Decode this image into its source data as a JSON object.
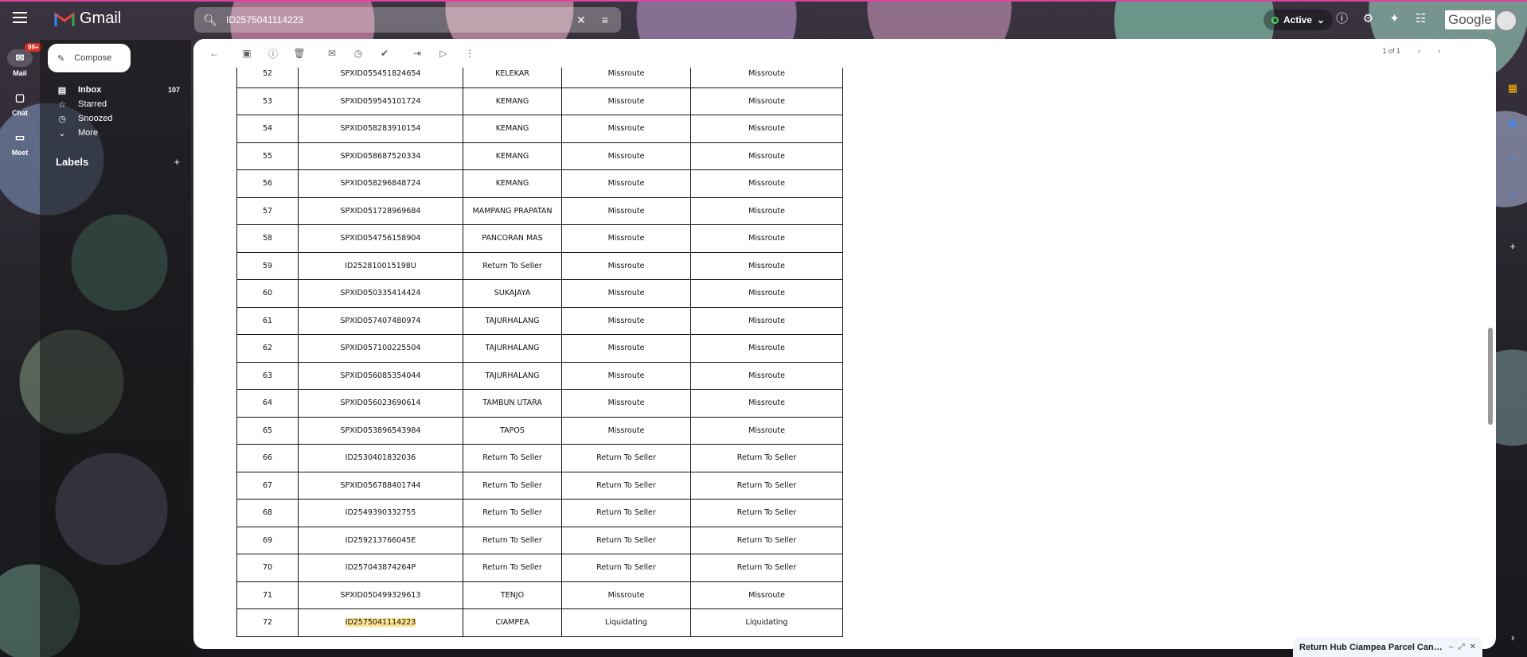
{
  "app": {
    "name": "Gmail"
  },
  "search": {
    "value": "ID2575041114223"
  },
  "status": {
    "label": "Active"
  },
  "google_label": "Google",
  "rail": {
    "mail": "Mail",
    "mail_badge": "99+",
    "chat": "Chat",
    "meet": "Meet"
  },
  "compose_label": "Compose",
  "nav": {
    "inbox": "Inbox",
    "inbox_count": "107",
    "starred": "Starred",
    "snoozed": "Snoozed",
    "more": "More",
    "labels": "Labels"
  },
  "pager": {
    "text": "1 of 1"
  },
  "table": {
    "rows": [
      [
        "52",
        "SPXID055451824654",
        "KELEKAR",
        "Missroute",
        "Missroute"
      ],
      [
        "53",
        "SPXID059545101724",
        "KEMANG",
        "Missroute",
        "Missroute"
      ],
      [
        "54",
        "SPXID058283910154",
        "KEMANG",
        "Missroute",
        "Missroute"
      ],
      [
        "55",
        "SPXID058687520334",
        "KEMANG",
        "Missroute",
        "Missroute"
      ],
      [
        "56",
        "SPXID058296848724",
        "KEMANG",
        "Missroute",
        "Missroute"
      ],
      [
        "57",
        "SPXID051728969684",
        "MAMPANG PRAPATAN",
        "Missroute",
        "Missroute"
      ],
      [
        "58",
        "SPXID054756158904",
        "PANCORAN MAS",
        "Missroute",
        "Missroute"
      ],
      [
        "59",
        "ID252810015198U",
        "Return To Seller",
        "Missroute",
        "Missroute"
      ],
      [
        "60",
        "SPXID050335414424",
        "SUKAJAYA",
        "Missroute",
        "Missroute"
      ],
      [
        "61",
        "SPXID057407480974",
        "TAJURHALANG",
        "Missroute",
        "Missroute"
      ],
      [
        "62",
        "SPXID057100225504",
        "TAJURHALANG",
        "Missroute",
        "Missroute"
      ],
      [
        "63",
        "SPXID056085354044",
        "TAJURHALANG",
        "Missroute",
        "Missroute"
      ],
      [
        "64",
        "SPXID056023690614",
        "TAMBUN UTARA",
        "Missroute",
        "Missroute"
      ],
      [
        "65",
        "SPXID053896543984",
        "TAPOS",
        "Missroute",
        "Missroute"
      ],
      [
        "66",
        "ID2530401832036",
        "Return To Seller",
        "Return To Seller",
        "Return To Seller"
      ],
      [
        "67",
        "SPXID056788401744",
        "Return To Seller",
        "Return To Seller",
        "Return To Seller"
      ],
      [
        "68",
        "ID2549390332755",
        "Return To Seller",
        "Return To Seller",
        "Return To Seller"
      ],
      [
        "69",
        "ID259213766045E",
        "Return To Seller",
        "Return To Seller",
        "Return To Seller"
      ],
      [
        "70",
        "ID257043874264P",
        "Return To Seller",
        "Return To Seller",
        "Return To Seller"
      ],
      [
        "71",
        "SPXID050499329613",
        "TENJO",
        "Missroute",
        "Missroute"
      ],
      [
        "72",
        "ID2575041114223",
        "CIAMPEA",
        "Liquidating",
        "Liquidating"
      ]
    ],
    "highlight_text": "ID2575041114223"
  },
  "minimized_draft": {
    "title": "Return Hub Ciampea Parcel Canc..."
  },
  "colors": {
    "accent": "#0b57d0",
    "highlight": "#fde293",
    "badge": "#d93025",
    "active_dot": "#4cd964"
  }
}
